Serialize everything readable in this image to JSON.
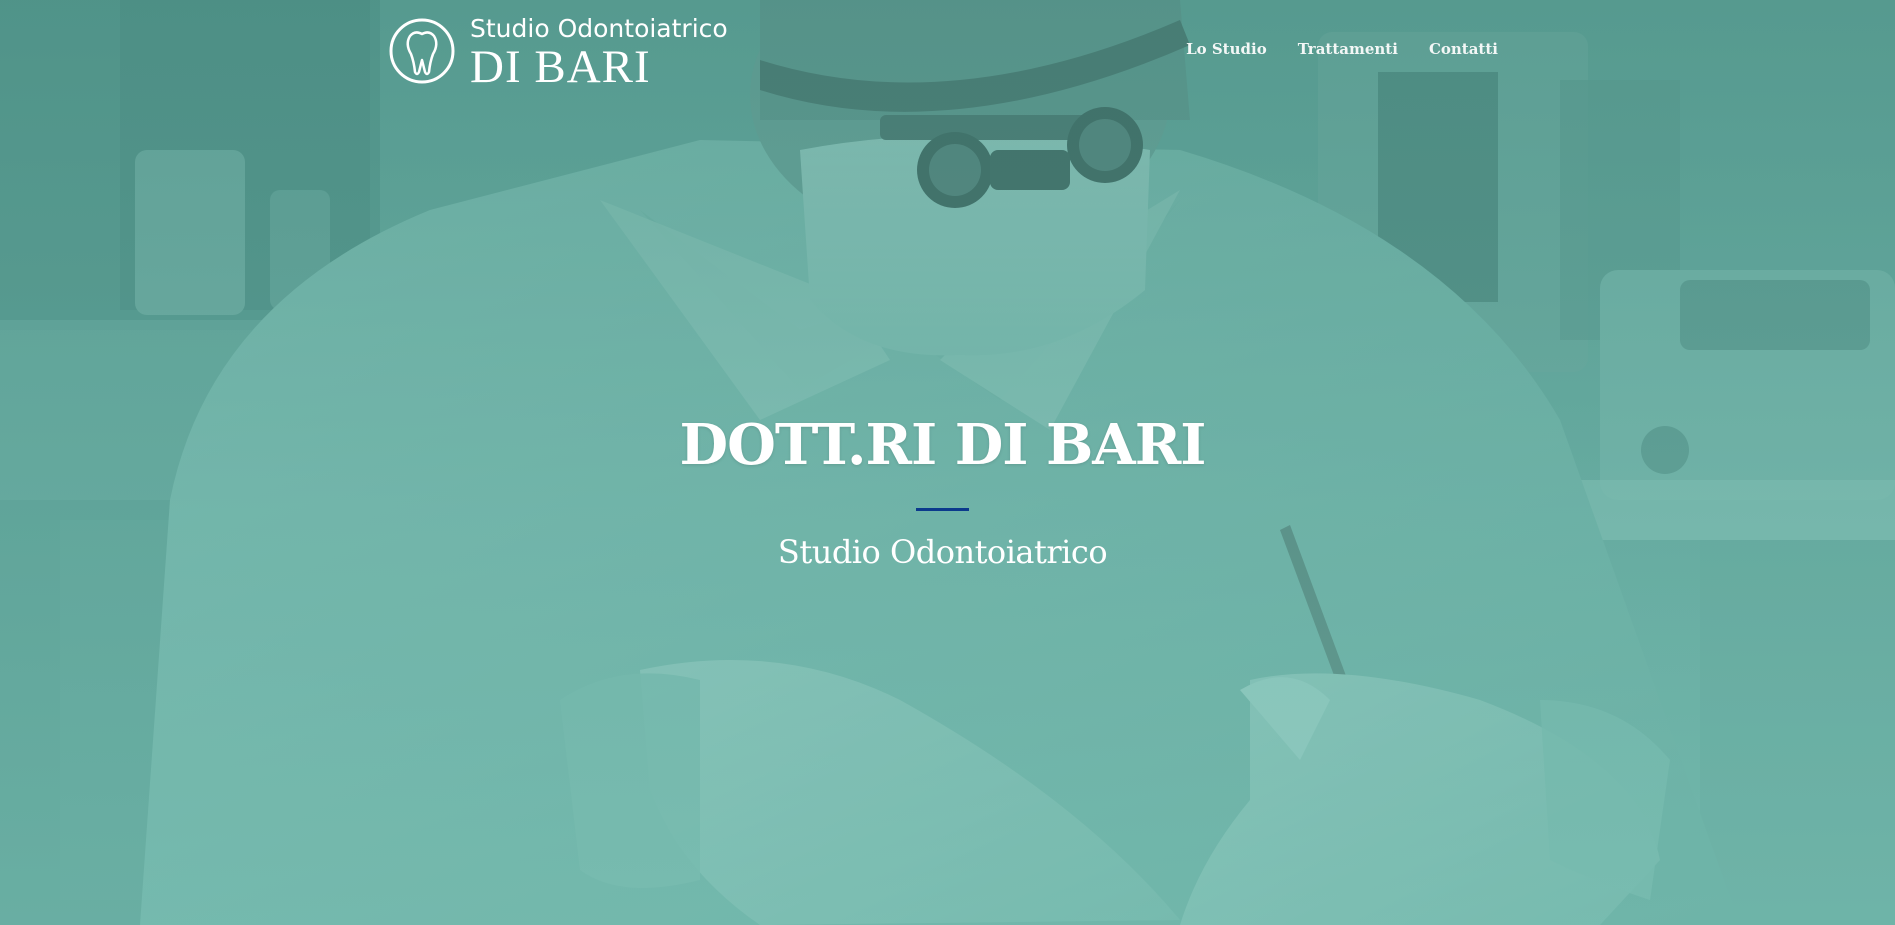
{
  "header": {
    "logo": {
      "line1": "Studio Odontoiatrico",
      "line2": "DI BARI",
      "icon": "tooth-icon"
    },
    "nav": [
      {
        "label": "Lo Studio"
      },
      {
        "label": "Trattamenti"
      },
      {
        "label": "Contatti"
      }
    ]
  },
  "hero": {
    "title": "DOTT.RI DI BARI",
    "subtitle": "Studio Odontoiatrico",
    "background": "dentist-at-work-photo"
  },
  "colors": {
    "overlay": "#5aa89b",
    "divider": "#0b3a8c",
    "text": "#ffffff"
  }
}
